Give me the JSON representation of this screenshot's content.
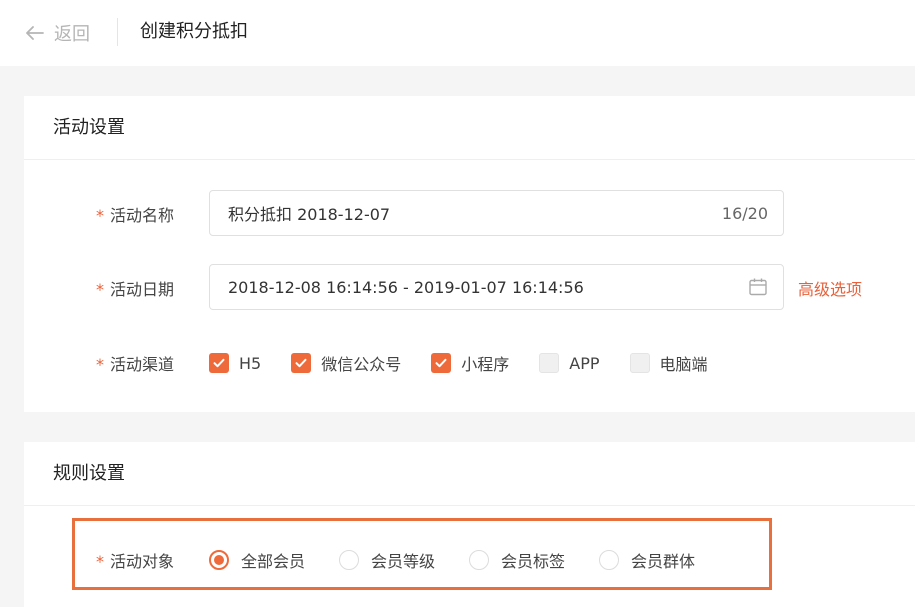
{
  "header": {
    "back_label": "返回",
    "title": "创建积分抵扣"
  },
  "activity_settings": {
    "title": "活动设置",
    "name": {
      "required_mark": "*",
      "label": "活动名称",
      "value": "积分抵扣  2018-12-07",
      "count": "16/20"
    },
    "date": {
      "required_mark": "*",
      "label": "活动日期",
      "value": "2018-12-08 16:14:56 - 2019-01-07 16:14:56",
      "advanced_label": "高级选项"
    },
    "channel": {
      "required_mark": "*",
      "label": "活动渠道",
      "options": [
        {
          "label": "H5",
          "checked": true
        },
        {
          "label": "微信公众号",
          "checked": true
        },
        {
          "label": "小程序",
          "checked": true
        },
        {
          "label": "APP",
          "checked": false
        },
        {
          "label": "电脑端",
          "checked": false
        }
      ]
    }
  },
  "rule_settings": {
    "title": "规则设置",
    "target": {
      "required_mark": "*",
      "label": "活动对象",
      "options": [
        {
          "label": "全部会员",
          "selected": true
        },
        {
          "label": "会员等级",
          "selected": false
        },
        {
          "label": "会员标签",
          "selected": false
        },
        {
          "label": "会员群体",
          "selected": false
        }
      ]
    }
  },
  "colors": {
    "accent": "#ef6a3a",
    "highlight_border": "#e8703d"
  }
}
